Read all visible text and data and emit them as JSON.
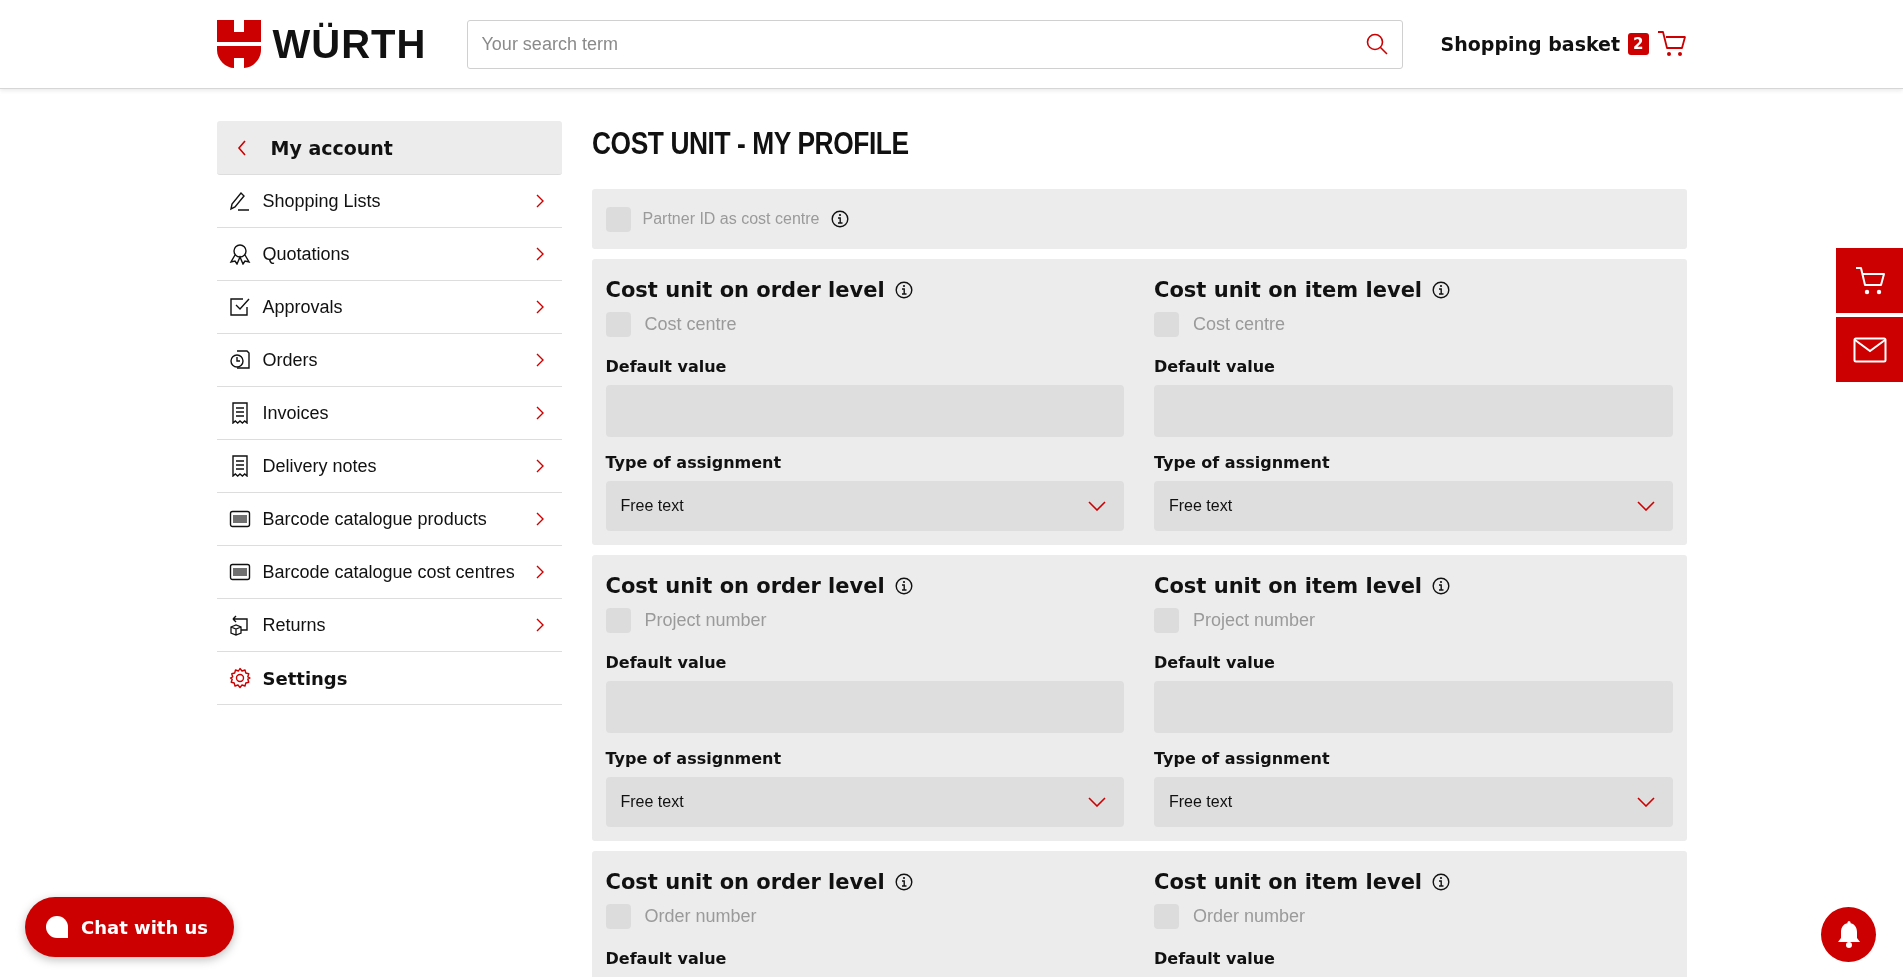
{
  "header": {
    "logo_text": "WÜRTH",
    "search": {
      "placeholder": "Your search term"
    },
    "basket": {
      "label": "Shopping basket",
      "count": "2"
    }
  },
  "sidebar": {
    "back_item": {
      "label": "My account"
    },
    "items": [
      {
        "label": "Shopping Lists",
        "kind": "link"
      },
      {
        "label": "Quotations",
        "kind": "link"
      },
      {
        "label": "Approvals",
        "kind": "link"
      },
      {
        "label": "Orders",
        "kind": "link"
      },
      {
        "label": "Invoices",
        "kind": "link"
      },
      {
        "label": "Delivery notes",
        "kind": "link"
      },
      {
        "label": "Barcode catalogue products",
        "kind": "link"
      },
      {
        "label": "Barcode catalogue cost centres",
        "kind": "link"
      },
      {
        "label": "Returns",
        "kind": "link"
      },
      {
        "label": "Settings",
        "kind": "settings"
      }
    ]
  },
  "main": {
    "title": "COST UNIT - MY PROFILE",
    "partner_option": {
      "label": "Partner ID as cost centre",
      "checked": false,
      "disabled": true
    },
    "sections": [
      {
        "columns": [
          {
            "heading": "Cost unit on order level",
            "option": {
              "label": "Cost centre",
              "checked": false,
              "disabled": true
            },
            "default_value_label": "Default value",
            "assignment_label": "Type of assignment",
            "assignment_value": "Free text"
          },
          {
            "heading": "Cost unit on item level",
            "option": {
              "label": "Cost centre",
              "checked": false,
              "disabled": true
            },
            "default_value_label": "Default value",
            "assignment_label": "Type of assignment",
            "assignment_value": "Free text"
          }
        ]
      },
      {
        "columns": [
          {
            "heading": "Cost unit on order level",
            "option": {
              "label": "Project number",
              "checked": false,
              "disabled": true
            },
            "default_value_label": "Default value",
            "assignment_label": "Type of assignment",
            "assignment_value": "Free text"
          },
          {
            "heading": "Cost unit on item level",
            "option": {
              "label": "Project number",
              "checked": false,
              "disabled": true
            },
            "default_value_label": "Default value",
            "assignment_label": "Type of assignment",
            "assignment_value": "Free text"
          }
        ]
      },
      {
        "columns": [
          {
            "heading": "Cost unit on order level",
            "option": {
              "label": "Order number",
              "checked": false,
              "disabled": true
            },
            "default_value_label": "Default value"
          },
          {
            "heading": "Cost unit on item level",
            "option": {
              "label": "Order number",
              "checked": false,
              "disabled": true
            },
            "default_value_label": "Default value"
          }
        ]
      }
    ]
  },
  "chat_button": {
    "label": "Chat with us"
  }
}
